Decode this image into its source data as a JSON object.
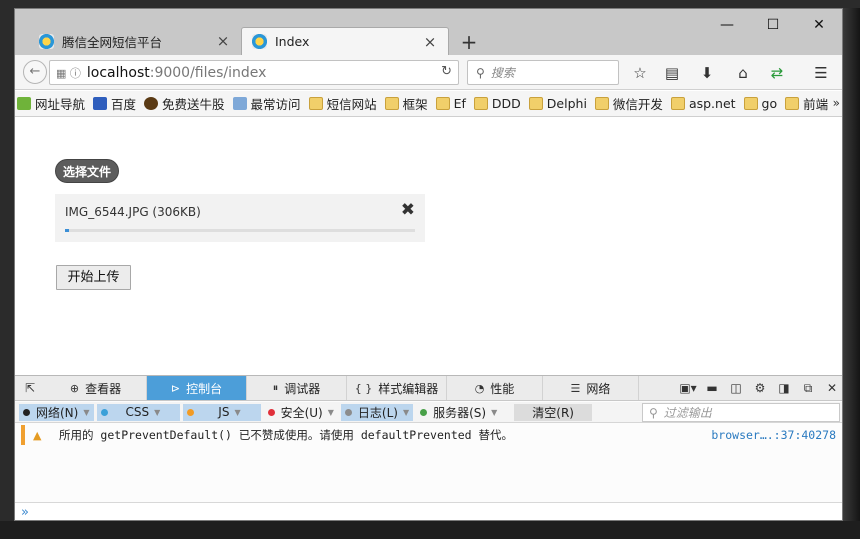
{
  "browser": {
    "tabs": [
      {
        "title": "腾信全网短信平台",
        "close": "×",
        "active": false
      },
      {
        "title": "Index",
        "close": "×",
        "active": true
      }
    ],
    "new_tab": "+",
    "window_controls": {
      "minimize": "—",
      "maximize": "☐",
      "close": "✕"
    },
    "url": {
      "host": "localhost",
      "rest": ":9000/files/index"
    },
    "search_placeholder": "搜索",
    "bookmarks": [
      {
        "label": "网址导航",
        "icon": "web-icon"
      },
      {
        "label": "百度",
        "icon": "baidu-icon"
      },
      {
        "label": "免费送牛股",
        "icon": "bull-icon"
      },
      {
        "label": "最常访问",
        "icon": "page-icon"
      },
      {
        "label": "短信网站",
        "icon": "folder-icon"
      },
      {
        "label": "框架",
        "icon": "folder-icon"
      },
      {
        "label": "Ef",
        "icon": "folder-icon"
      },
      {
        "label": "DDD",
        "icon": "folder-icon"
      },
      {
        "label": "Delphi",
        "icon": "folder-icon"
      },
      {
        "label": "微信开发",
        "icon": "folder-icon"
      },
      {
        "label": "asp.net",
        "icon": "folder-icon"
      },
      {
        "label": "go",
        "icon": "folder-icon"
      },
      {
        "label": "前端",
        "icon": "folder-icon"
      }
    ],
    "bookmarks_more": "»"
  },
  "page": {
    "pick_button": "选择文件",
    "file": {
      "name": "IMG_6544.JPG (306KB)",
      "remove": "✖",
      "progress": 0.01
    },
    "upload_button": "开始上传"
  },
  "devtools": {
    "tabs": [
      {
        "label": "查看器",
        "icon": "inspector-icon",
        "glyph": "⊕"
      },
      {
        "label": "控制台",
        "icon": "console-icon",
        "glyph": "⊳",
        "active": true
      },
      {
        "label": "调试器",
        "icon": "debugger-icon",
        "glyph": "⏸"
      },
      {
        "label": "样式编辑器",
        "icon": "style-editor-icon",
        "glyph": "{ }"
      },
      {
        "label": "性能",
        "icon": "performance-icon",
        "glyph": "◔"
      },
      {
        "label": "网络",
        "icon": "network-icon",
        "glyph": "☰"
      }
    ],
    "filters": [
      {
        "label": "网络(N)",
        "color": "#222222",
        "on": true
      },
      {
        "label": "CSS",
        "color": "#3aa0d8",
        "on": true
      },
      {
        "label": "JS",
        "color": "#f29b24",
        "on": true
      },
      {
        "label": "安全(U)",
        "color": "#e0303a",
        "on": false
      },
      {
        "label": "日志(L)",
        "color": "#8c8c8c",
        "on": true
      },
      {
        "label": "服务器(S)",
        "color": "#48a048",
        "on": false
      }
    ],
    "clear_button": "清空(R)",
    "filter_placeholder": "过滤输出",
    "log": {
      "level": "warning",
      "message": "所用的 getPreventDefault() 已不赞成使用。请使用 defaultPrevented 替代。",
      "source": "browser….:37:40278"
    },
    "prompt": "»"
  },
  "colors": {
    "accent": "#4c9ed9",
    "warning": "#f0a030",
    "link": "#2a7ac0"
  }
}
